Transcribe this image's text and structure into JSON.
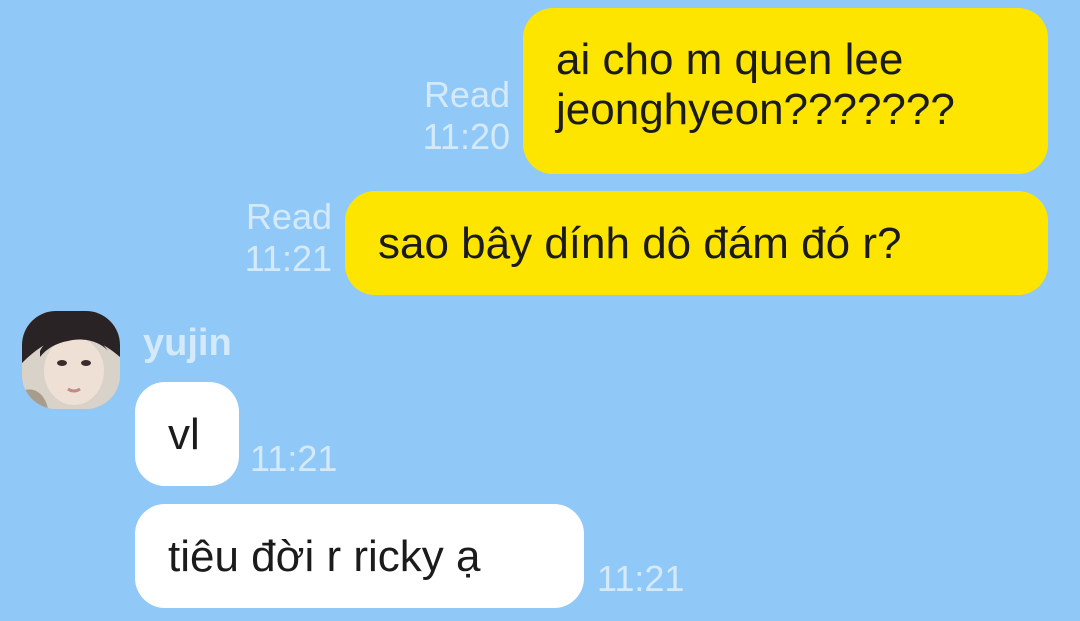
{
  "colors": {
    "background": "#90C9F7",
    "outgoing_bubble": "#FEE500",
    "incoming_bubble": "#FFFFFF",
    "meta_text": "#D4EAFB"
  },
  "messages": {
    "m1": {
      "line1": "ai cho m quen lee",
      "line2": "jeonghyeon???????",
      "read": "Read",
      "time": "11:20"
    },
    "m2": {
      "text": "sao bây dính dô đám đó r?",
      "read": "Read",
      "time": "11:21"
    },
    "sender": {
      "name": "yujin",
      "avatar_icon": "profile-photo"
    },
    "m3": {
      "text": "vl",
      "time": "11:21"
    },
    "m4": {
      "text": "tiêu đời r ricky ạ",
      "time": "11:21"
    }
  }
}
